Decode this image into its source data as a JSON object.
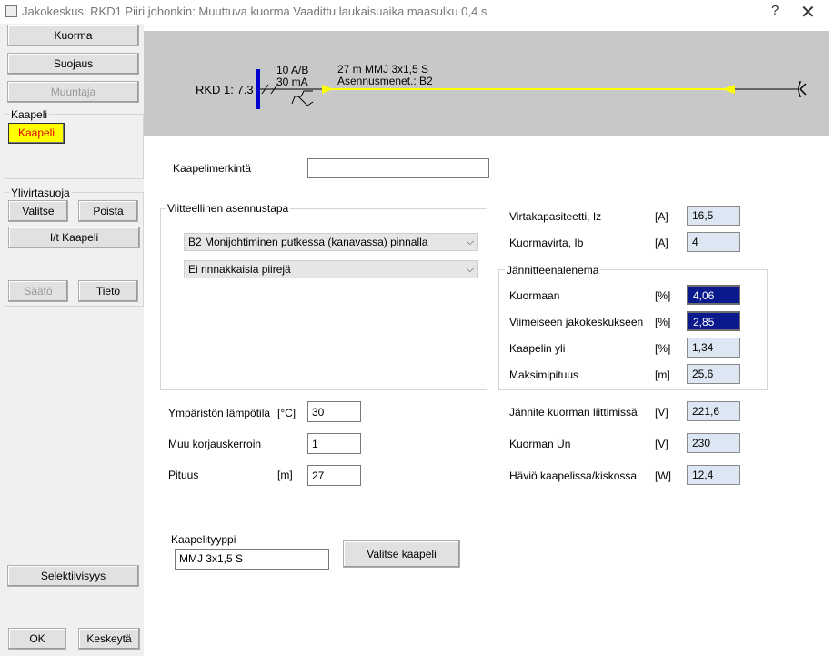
{
  "window": {
    "title": "Jakokeskus: RKD1    Piiri johonkin: Muuttuva kuorma   Vaadittu laukaisuaika maasulku 0,4 s",
    "help": "?",
    "close": "✕"
  },
  "left": {
    "kuorma": "Kuorma",
    "suojaus": "Suojaus",
    "muuntaja": "Muuntaja",
    "kaapeli_group": "Kaapeli",
    "kaapeli_btn": "Kaapeli",
    "ylivirtasuoja_group": "Ylivirtasuoja",
    "valitse": "Valitse",
    "poista": "Poista",
    "it_kaapeli": "I/t Kaapeli",
    "saato": "Säätö",
    "tieto": "Tieto",
    "selektiivisyys": "Selektiivisyys",
    "ok": "OK",
    "keskeyta": "Keskeytä"
  },
  "diagram": {
    "source": "RKD 1: 7.3",
    "protect_rating": "10 A/B",
    "rcd": "30 mA",
    "cable": "27 m  MMJ 3x1,5 S",
    "install": "Asennusmenet.: B2",
    "line_color": "#ffff00",
    "bus_color": "#0000cc"
  },
  "form": {
    "kaapelimerkinta_label": "Kaapelimerkintä",
    "kaapelimerkinta_value": "",
    "asennustapa_group": "Viitteellinen asennustapa",
    "asennustapa_select": "B2 Monijohtiminen putkessa (kanavassa) pinnalla",
    "rinnakkais_select": "Ei rinnakkaisia piirejä",
    "lampotila_label": "Ympäristön lämpötila",
    "lampotila_unit": "[°C]",
    "lampotila_value": "30",
    "korjaus_label": "Muu korjauskerroin",
    "korjaus_value": "1",
    "pituus_label": "Pituus",
    "pituus_unit": "[m]",
    "pituus_value": "27",
    "kaapelityyppi_label": "Kaapelityyppi",
    "kaapelityyppi_value": "MMJ 3x1,5 S",
    "valitse_kaapeli": "Valitse kaapeli"
  },
  "results": {
    "iz_label": "Virtakapasiteetti, Iz",
    "iz_unit": "[A]",
    "iz_value": "16,5",
    "ib_label": "Kuormavirta, Ib",
    "ib_unit": "[A]",
    "ib_value": "4",
    "jannite_group": "Jännitteenalenema",
    "kuormaan_label": "Kuormaan",
    "kuormaan_unit": "[%]",
    "kuormaan_value": "4,06",
    "viimeiseen_label": "Viimeiseen jakokeskukseen",
    "viimeiseen_unit": "[%]",
    "viimeiseen_value": "2,85",
    "kaapelin_label": "Kaapelin yli",
    "kaapelin_unit": "[%]",
    "kaapelin_value": "1,34",
    "maksimi_label": "Maksimipituus",
    "maksimi_unit": "[m]",
    "maksimi_value": "25,6",
    "jk_label": "Jännite kuorman liittimissä",
    "jk_unit": "[V]",
    "jk_value": "221,6",
    "un_label": "Kuorman Un",
    "un_unit": "[V]",
    "un_value": "230",
    "havio_label": "Häviö kaapelissa/kiskossa",
    "havio_unit": "[W]",
    "havio_value": "12,4"
  }
}
